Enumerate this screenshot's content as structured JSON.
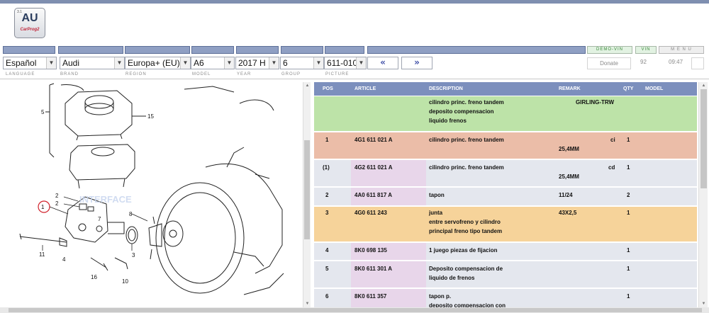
{
  "logo": {
    "name": "AU",
    "tagline": "CarProg2",
    "small": "3.1"
  },
  "header_buttons": {
    "demo_vin": "DEMO-VIN",
    "vin": "VIN",
    "menu": "M E N U"
  },
  "selectors": {
    "language": "Español",
    "brand": "Audi",
    "region": "Europa+ (EU)",
    "model": "A6",
    "year": "2017 H",
    "group": "6",
    "picture": "611-010"
  },
  "nav": {
    "prev": "«",
    "next": "»"
  },
  "info": {
    "donate": "Donate",
    "count": "92",
    "time": "09:47"
  },
  "captions": {
    "language": "LANGUAGE",
    "brand": "BRAND",
    "region": "REGION",
    "model": "MODEL",
    "year": "YEAR",
    "group": "GROUP",
    "picture": "PICTURE"
  },
  "diagram": {
    "labels": [
      "5",
      "15",
      "2",
      "2",
      "1",
      "8",
      "3",
      "11",
      "4",
      "16",
      "10",
      "7"
    ],
    "watermark": "INTERFACE"
  },
  "table": {
    "headers": {
      "pos": "POS",
      "article": "ARTICLE",
      "description": "DESCRIPTION",
      "remark": "REMARK",
      "qty": "QTY",
      "model": "MODEL"
    },
    "rows": [
      {
        "pos": "",
        "article": "",
        "desc": [
          "cilindro princ. freno tandem",
          "deposito compensacion",
          "liquido frenos"
        ],
        "remark": [
          "GIRLING-TRW"
        ],
        "qty": ""
      },
      {
        "pos": "1",
        "article": "4G1 611 021 A",
        "desc": [
          "cilindro princ. freno tandem"
        ],
        "remark": [
          "ci",
          "25,4MM"
        ],
        "qty": "1"
      },
      {
        "pos": "(1)",
        "article": "4G2 611 021 A",
        "desc": [
          "cilindro princ. freno tandem"
        ],
        "remark": [
          "cd",
          "25,4MM"
        ],
        "qty": "1"
      },
      {
        "pos": "2",
        "article": "4A0 611 817 A",
        "desc": [
          "tapon"
        ],
        "remark": [
          "11/24"
        ],
        "qty": "2"
      },
      {
        "pos": "3",
        "article": "4G0 611 243",
        "desc": [
          "junta",
          "entre servofreno y cilindro",
          "principal freno tipo tandem"
        ],
        "remark": [
          "43X2,5"
        ],
        "qty": "1"
      },
      {
        "pos": "4",
        "article": "8K0 698 135",
        "desc": [
          "1 juego piezas de fijacion"
        ],
        "remark": [
          ""
        ],
        "qty": "1"
      },
      {
        "pos": "5",
        "article": "8K0 611 301 A",
        "desc": [
          "Deposito compensacion de",
          "liquido de frenos"
        ],
        "remark": [
          ""
        ],
        "qty": "1"
      },
      {
        "pos": "6",
        "article": "8K0 611 357",
        "desc": [
          "tapon p.",
          "deposito compensacion con"
        ],
        "remark": [
          ""
        ],
        "qty": "1"
      }
    ]
  },
  "colors": {
    "header_bar": "#8f9fc3",
    "table_header": "#7c8fbd",
    "green_row": "#bde3a8",
    "salmon_row": "#ebbda8",
    "orange_row": "#f6d39a",
    "grey_row": "#e4e7ee",
    "article_cell": "#e8d6ea"
  }
}
